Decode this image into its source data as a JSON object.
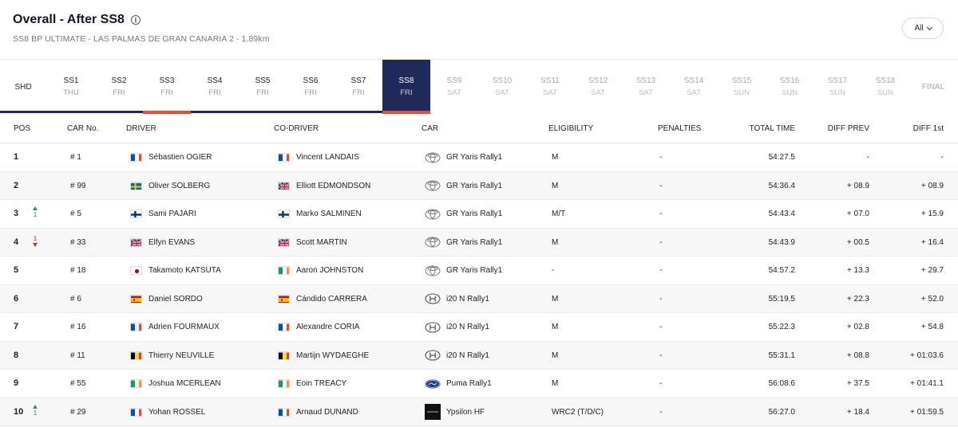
{
  "header": {
    "title": "Overall - After SS8",
    "subtitle": "SS8 BP ULTIMATE - LAS PALMAS DE GRAN CANARIA 2 - 1.89km",
    "filter_label": "All"
  },
  "stages": [
    {
      "name": "SHD",
      "day": ""
    },
    {
      "name": "SS1",
      "day": "THU"
    },
    {
      "name": "SS2",
      "day": "FRI"
    },
    {
      "name": "SS3",
      "day": "FRI"
    },
    {
      "name": "SS4",
      "day": "FRI"
    },
    {
      "name": "SS5",
      "day": "FRI"
    },
    {
      "name": "SS6",
      "day": "FRI"
    },
    {
      "name": "SS7",
      "day": "FRI"
    },
    {
      "name": "SS8",
      "day": "FRI"
    },
    {
      "name": "SS9",
      "day": "SAT"
    },
    {
      "name": "SS10",
      "day": "SAT"
    },
    {
      "name": "SS11",
      "day": "SAT"
    },
    {
      "name": "SS12",
      "day": "SAT"
    },
    {
      "name": "SS13",
      "day": "SAT"
    },
    {
      "name": "SS14",
      "day": "SAT"
    },
    {
      "name": "SS15",
      "day": "SUN"
    },
    {
      "name": "SS16",
      "day": "SUN"
    },
    {
      "name": "SS17",
      "day": "SUN"
    },
    {
      "name": "SS18",
      "day": "SUN"
    },
    {
      "name": "FINAL",
      "day": ""
    }
  ],
  "colors": {
    "navy": "#1f2a5b",
    "accent": "#ee4a2d",
    "up": "#2a9d3c",
    "down": "#d32f2f"
  },
  "table": {
    "columns": {
      "pos": "POS",
      "car_no": "CAR No.",
      "driver": "DRIVER",
      "codriver": "CO-DRIVER",
      "car": "CAR",
      "eligibility": "ELIGIBILITY",
      "penalties": "PENALTIES",
      "total": "TOTAL TIME",
      "diff_prev": "DIFF PREV",
      "diff_first": "DIFF 1st"
    },
    "rows": [
      {
        "pos": "1",
        "trend": "",
        "trend_n": "",
        "car_no": "# 1",
        "driver": "Sébastien OGIER",
        "driver_flag": "france-flag",
        "codriver": "Vincent LANDAIS",
        "codriver_flag": "france-flag",
        "brand": "toyota-logo",
        "car": "GR Yaris Rally1",
        "eligibility": "M",
        "penalties": "-",
        "total": "54:27.5",
        "diff_prev": "-",
        "diff_first": "-"
      },
      {
        "pos": "2",
        "trend": "",
        "trend_n": "",
        "car_no": "# 99",
        "driver": "Oliver SOLBERG",
        "driver_flag": "sweden-flag",
        "codriver": "Elliott EDMONDSON",
        "codriver_flag": "uk-flag",
        "brand": "toyota-logo",
        "car": "GR Yaris Rally1",
        "eligibility": "M",
        "penalties": "-",
        "total": "54:36.4",
        "diff_prev": "+ 08.9",
        "diff_first": "+ 08.9"
      },
      {
        "pos": "3",
        "trend": "up",
        "trend_n": "1",
        "car_no": "# 5",
        "driver": "Sami PAJARI",
        "driver_flag": "finland-flag",
        "codriver": "Marko SALMINEN",
        "codriver_flag": "finland-flag",
        "brand": "toyota-logo",
        "car": "GR Yaris Rally1",
        "eligibility": "M/T",
        "penalties": "-",
        "total": "54:43.4",
        "diff_prev": "+ 07.0",
        "diff_first": "+ 15.9"
      },
      {
        "pos": "4",
        "trend": "down",
        "trend_n": "1",
        "car_no": "# 33",
        "driver": "Elfyn EVANS",
        "driver_flag": "uk-flag",
        "codriver": "Scott MARTIN",
        "codriver_flag": "uk-flag",
        "brand": "toyota-logo",
        "car": "GR Yaris Rally1",
        "eligibility": "M",
        "penalties": "-",
        "total": "54:43.9",
        "diff_prev": "+ 00.5",
        "diff_first": "+ 16.4"
      },
      {
        "pos": "5",
        "trend": "",
        "trend_n": "",
        "car_no": "# 18",
        "driver": "Takamoto KATSUTA",
        "driver_flag": "japan-flag",
        "codriver": "Aaron JOHNSTON",
        "codriver_flag": "ireland-flag",
        "brand": "toyota-logo",
        "car": "GR Yaris Rally1",
        "eligibility": "-",
        "penalties": "-",
        "total": "54:57.2",
        "diff_prev": "+ 13.3",
        "diff_first": "+ 29.7"
      },
      {
        "pos": "6",
        "trend": "",
        "trend_n": "",
        "car_no": "# 6",
        "driver": "Daniel SORDO",
        "driver_flag": "spain-flag",
        "codriver": "Cándido CARRERA",
        "codriver_flag": "spain-flag",
        "brand": "hyundai-logo",
        "car": "i20 N Rally1",
        "eligibility": "M",
        "penalties": "-",
        "total": "55:19.5",
        "diff_prev": "+ 22.3",
        "diff_first": "+ 52.0"
      },
      {
        "pos": "7",
        "trend": "",
        "trend_n": "",
        "car_no": "# 16",
        "driver": "Adrien FOURMAUX",
        "driver_flag": "france-flag",
        "codriver": "Alexandre CORIA",
        "codriver_flag": "france-flag",
        "brand": "hyundai-logo",
        "car": "i20 N Rally1",
        "eligibility": "M",
        "penalties": "-",
        "total": "55:22.3",
        "diff_prev": "+ 02.8",
        "diff_first": "+ 54.8"
      },
      {
        "pos": "8",
        "trend": "",
        "trend_n": "",
        "car_no": "# 11",
        "driver": "Thierry NEUVILLE",
        "driver_flag": "belgium-flag",
        "codriver": "Martijn WYDAEGHE",
        "codriver_flag": "belgium-flag",
        "brand": "hyundai-logo",
        "car": "i20 N Rally1",
        "eligibility": "M",
        "penalties": "-",
        "total": "55:31.1",
        "diff_prev": "+ 08.8",
        "diff_first": "+ 01:03.6"
      },
      {
        "pos": "9",
        "trend": "",
        "trend_n": "",
        "car_no": "# 55",
        "driver": "Joshua MCERLEAN",
        "driver_flag": "ireland-flag",
        "codriver": "Eoin TREACY",
        "codriver_flag": "ireland-flag",
        "brand": "ford-logo",
        "car": "Puma Rally1",
        "eligibility": "M",
        "penalties": "-",
        "total": "56:08.6",
        "diff_prev": "+ 37.5",
        "diff_first": "+ 01:41.1"
      },
      {
        "pos": "10",
        "trend": "up",
        "trend_n": "1",
        "car_no": "# 29",
        "driver": "Yohan ROSSEL",
        "driver_flag": "france-flag",
        "codriver": "Arnaud DUNAND",
        "codriver_flag": "france-flag",
        "brand": "citroen-logo",
        "car": "Ypsilon HF",
        "eligibility": "WRC2 (T/D/C)",
        "penalties": "-",
        "total": "56:27.0",
        "diff_prev": "+ 18.4",
        "diff_first": "+ 01:59.5"
      }
    ]
  }
}
